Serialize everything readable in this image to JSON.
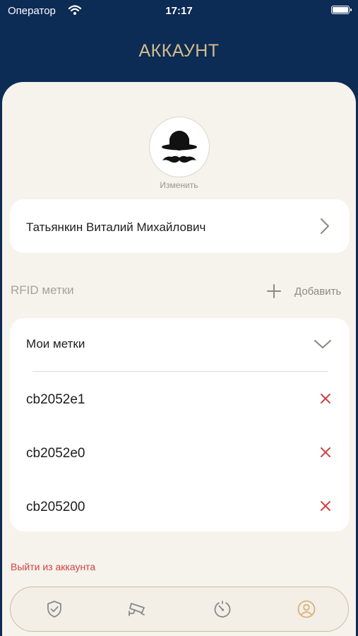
{
  "status_bar": {
    "carrier": "Оператор",
    "time": "17:17"
  },
  "header": {
    "title": "АККАУНТ"
  },
  "profile": {
    "avatar_icon": "bowler-hat-mustache-icon",
    "change_label": "Изменить",
    "full_name": "Татьянкин Виталий Михайлович"
  },
  "rfid": {
    "section_title": "RFID метки",
    "add_label": "Добавить",
    "list_title": "Мои метки",
    "tags": [
      {
        "code": "cb2052e1"
      },
      {
        "code": "cb2052e0"
      },
      {
        "code": "cb205200"
      }
    ]
  },
  "logout_label": "Выйти из аккаунта",
  "tab_bar": {
    "tabs": [
      {
        "icon": "shield-check-icon",
        "active": false
      },
      {
        "icon": "security-camera-icon",
        "active": false
      },
      {
        "icon": "speedometer-icon",
        "active": false
      },
      {
        "icon": "user-icon",
        "active": true
      }
    ]
  },
  "colors": {
    "header_bg": "#0c2b55",
    "accent_gold": "#d4bd8a",
    "sheet_bg": "#f6f2ec",
    "danger_red": "#cf4343",
    "tab_active": "#d9b07a",
    "tab_inactive": "#8a8a82"
  }
}
